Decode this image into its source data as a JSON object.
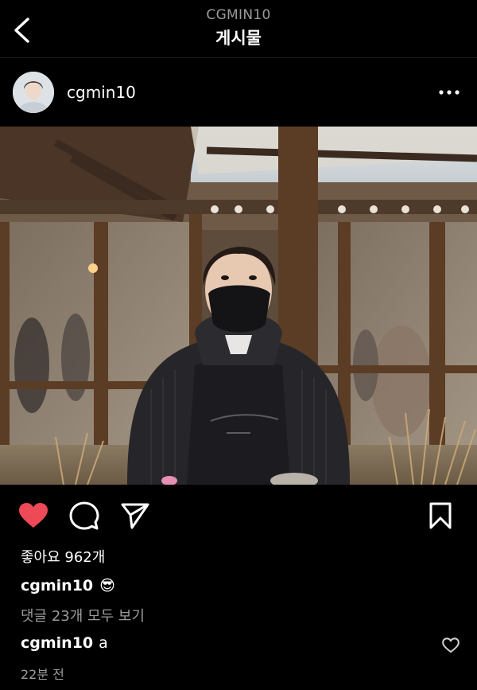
{
  "header": {
    "account": "CGMIN10",
    "title": "게시물"
  },
  "post": {
    "username": "cgmin10",
    "likes_text": "좋아요 962개",
    "caption_user": "cgmin10",
    "caption_emoji": "😎",
    "view_comments": "댓글 23개 모두 보기",
    "comment_user": "cgmin10",
    "comment_text": "a",
    "time": "22분 전",
    "liked": true
  },
  "colors": {
    "like_red": "#ed4956",
    "muted": "#9a9a9a"
  },
  "icons": {
    "back": "chevron-left-icon",
    "more": "more-horizontal-icon",
    "like": "heart-filled-icon",
    "comment": "comment-bubble-icon",
    "share": "send-icon",
    "save": "bookmark-icon",
    "comment_like": "heart-outline-icon"
  }
}
